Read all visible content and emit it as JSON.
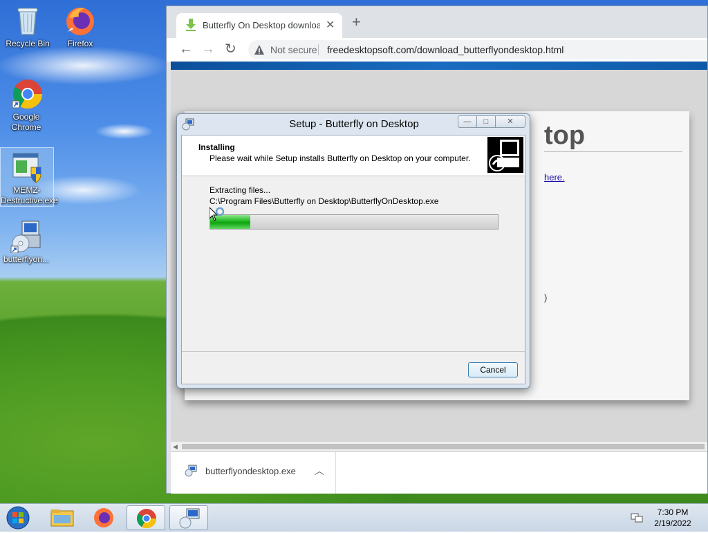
{
  "desktop": {
    "icons": [
      {
        "label": "Recycle Bin"
      },
      {
        "label": "Firefox"
      },
      {
        "label": "Google Chrome"
      },
      {
        "label": "MEMZ-Destructive.exe"
      },
      {
        "label": "butterflyon..."
      }
    ]
  },
  "browser": {
    "tab_title": "Butterfly On Desktop download",
    "not_secure": "Not secure",
    "url": "freedesktopsoft.com/download_butterflyondesktop.html",
    "page_heading_fragment": "top",
    "page_link_fragment": "here.",
    "page_paren_fragment": ")",
    "download_file": "butterflyondesktop.exe"
  },
  "setup": {
    "title": "Setup - Butterfly on Desktop",
    "heading": "Installing",
    "subheading": "Please wait while Setup installs Butterfly on Desktop on your computer.",
    "status": "Extracting files...",
    "file_path": "C:\\Program Files\\Butterfly on Desktop\\ButterflyOnDesktop.exe",
    "progress_fraction": 0.14,
    "cancel_label": "Cancel"
  },
  "taskbar": {
    "time": "7:30 PM",
    "date": "2/19/2022"
  },
  "colors": {
    "progress_green": "#1fb81f",
    "omnibox_bg": "#f1f3f4",
    "site_banner_blue": "#0b4f9a"
  }
}
